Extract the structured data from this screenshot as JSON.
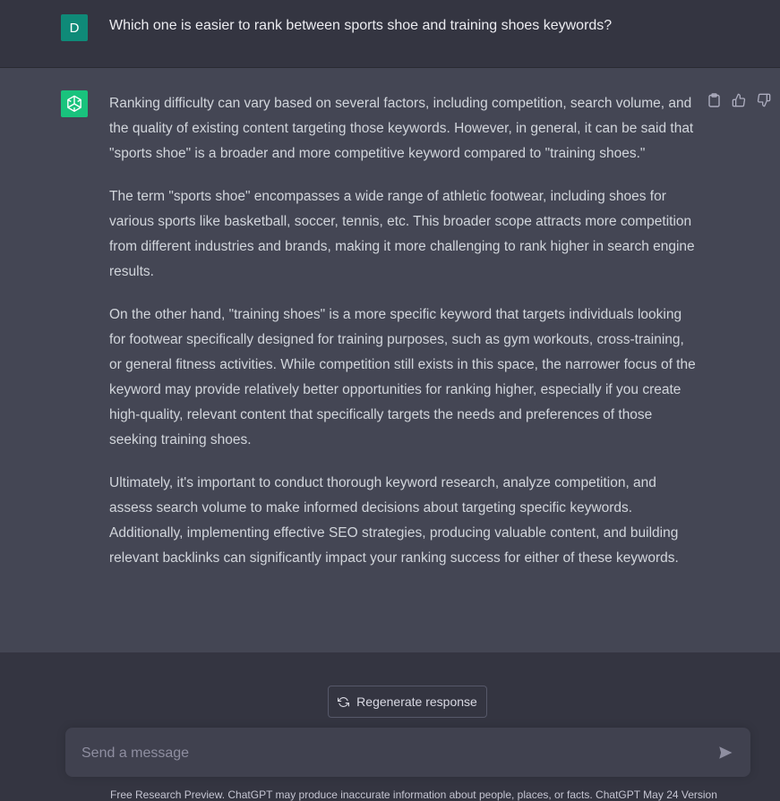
{
  "user_message": {
    "avatar_letter": "D",
    "text": "Which one is easier to rank between sports shoe and training shoes keywords?"
  },
  "assistant_message": {
    "paragraphs": [
      "Ranking difficulty can vary based on several factors, including competition, search volume, and the quality of existing content targeting those keywords. However, in general, it can be said that \"sports shoe\" is a broader and more competitive keyword compared to \"training shoes.\"",
      "The term \"sports shoe\" encompasses a wide range of athletic footwear, including shoes for various sports like basketball, soccer, tennis, etc. This broader scope attracts more competition from different industries and brands, making it more challenging to rank higher in search engine results.",
      "On the other hand, \"training shoes\" is a more specific keyword that targets individuals looking for footwear specifically designed for training purposes, such as gym workouts, cross-training, or general fitness activities. While competition still exists in this space, the narrower focus of the keyword may provide relatively better opportunities for ranking higher, especially if you create high-quality, relevant content that specifically targets the needs and preferences of those seeking training shoes.",
      "Ultimately, it's important to conduct thorough keyword research, analyze competition, and assess search volume to make informed decisions about targeting specific keywords. Additionally, implementing effective SEO strategies, producing valuable content, and building relevant backlinks can significantly impact your ranking success for either of these keywords."
    ]
  },
  "controls": {
    "regenerate_label": "Regenerate response",
    "input_placeholder": "Send a message",
    "footer_note": "Free Research Preview. ChatGPT may produce inaccurate information about people, places, or facts. ChatGPT May 24 Version"
  },
  "icons": {
    "copy": "clipboard-icon",
    "thumbs_up": "thumbs-up-icon",
    "thumbs_down": "thumbs-down-icon",
    "regenerate": "refresh-icon",
    "send": "send-icon",
    "bot_logo": "openai-logo-icon"
  },
  "colors": {
    "user_bg": "#343541",
    "assistant_bg": "#444654",
    "user_avatar": "#0f8a78",
    "bot_avatar": "#19c37d"
  }
}
